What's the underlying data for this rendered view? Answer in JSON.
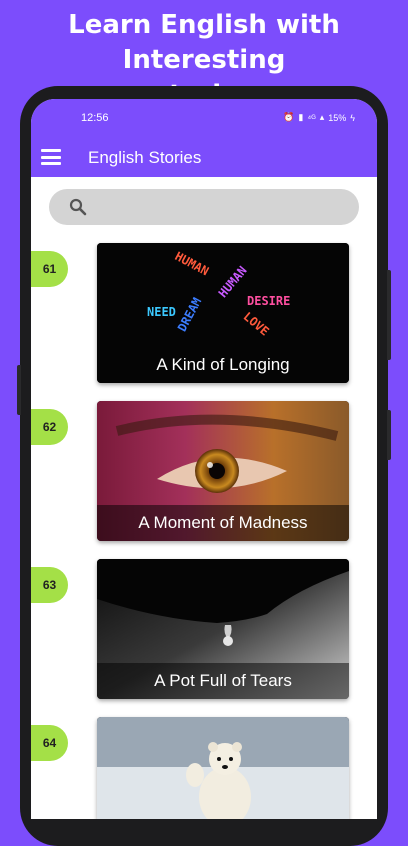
{
  "promo": {
    "line1": "Learn English with Interesting",
    "line2": "stories"
  },
  "status": {
    "time": "12:56",
    "battery": "15%",
    "signal": "⁴ᴳ"
  },
  "app": {
    "title": "English Stories"
  },
  "search": {
    "placeholder": ""
  },
  "stories": [
    {
      "number": "61",
      "title": "A Kind of Longing",
      "art_words": [
        "HUMAN",
        "DESIRE",
        "NEED",
        "DREAM",
        "HUMAN",
        "LOVE"
      ]
    },
    {
      "number": "62",
      "title": "A Moment of Madness"
    },
    {
      "number": "63",
      "title": "A Pot Full of Tears"
    },
    {
      "number": "64",
      "title": ""
    }
  ],
  "colors": {
    "primary": "#7c4dfc",
    "badge": "#a4e047",
    "search_bg": "#d4d4d4"
  }
}
